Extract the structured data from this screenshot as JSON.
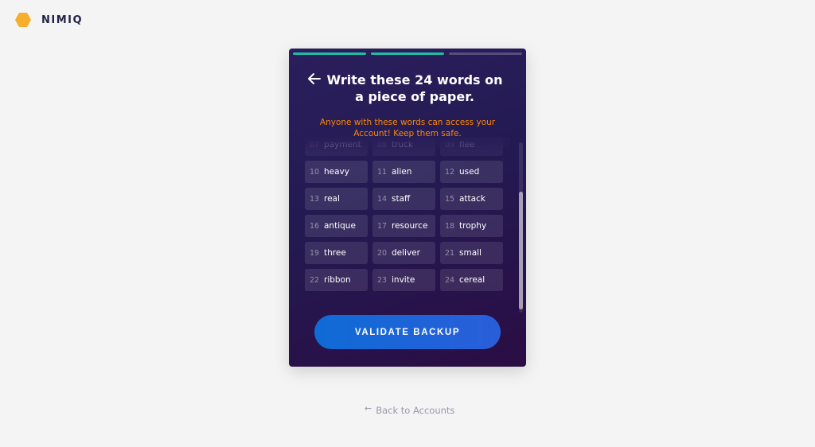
{
  "brand": {
    "name": "NIMIQ",
    "logo_color": "#f6ae2d"
  },
  "card": {
    "progress_steps": [
      "done",
      "done",
      "todo"
    ],
    "title_line1": "Write these 24 words on",
    "title_line2": "a piece of paper.",
    "warning_line1": "Anyone with these words can access your",
    "warning_line2": "Account! Keep them safe.",
    "words": [
      {
        "num": "07",
        "word": "payment"
      },
      {
        "num": "08",
        "word": "truck"
      },
      {
        "num": "09",
        "word": "flee"
      },
      {
        "num": "10",
        "word": "heavy"
      },
      {
        "num": "11",
        "word": "alien"
      },
      {
        "num": "12",
        "word": "used"
      },
      {
        "num": "13",
        "word": "real"
      },
      {
        "num": "14",
        "word": "staff"
      },
      {
        "num": "15",
        "word": "attack"
      },
      {
        "num": "16",
        "word": "antique"
      },
      {
        "num": "17",
        "word": "resource"
      },
      {
        "num": "18",
        "word": "trophy"
      },
      {
        "num": "19",
        "word": "three"
      },
      {
        "num": "20",
        "word": "deliver"
      },
      {
        "num": "21",
        "word": "small"
      },
      {
        "num": "22",
        "word": "ribbon"
      },
      {
        "num": "23",
        "word": "invite"
      },
      {
        "num": "24",
        "word": "cereal"
      }
    ],
    "validate_label": "VALIDATE BACKUP",
    "accent_color": "#21bca5",
    "warning_color": "#fc8702"
  },
  "footer": {
    "back_label": "Back to Accounts"
  }
}
